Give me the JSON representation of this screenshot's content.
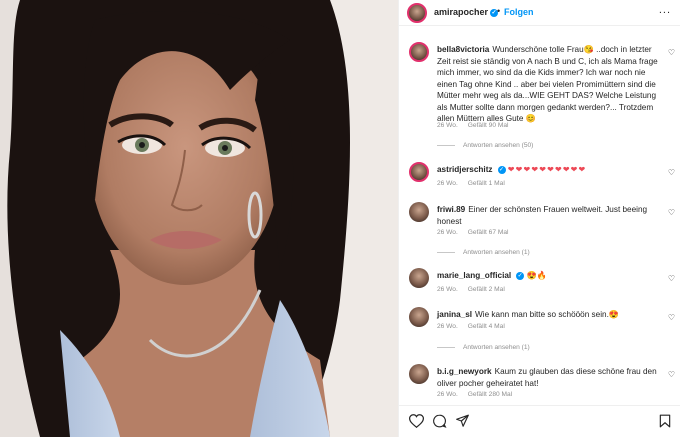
{
  "header": {
    "username": "amirapocher",
    "separator": "•",
    "follow_label": "Folgen",
    "more": "..."
  },
  "comments": [
    {
      "user": "bella8victoria",
      "text": "Wunderschöne tolle Frau😘 ..doch in letzter Zeit reist sie ständig von A nach B und C, ich als Mama frage mich immer, wo sind da die Kids immer? Ich war noch nie einen Tag ohne Kind .. aber bei vielen Promimüttern sind die Mütter mehr weg als da...WIE GEHT DAS? Welche Leistung als Mutter sollte dann morgen gedankt werden?... Trotzdem allen Müttern alles Gute 😊",
      "age": "26 Wo.",
      "likes": "Gefällt 90 Mal",
      "replies": "Antworten ansehen (50)"
    },
    {
      "user": "astridjerschitz",
      "text": "❤❤❤❤❤❤❤❤❤❤",
      "age": "26 Wo.",
      "likes": "Gefällt 1 Mal"
    },
    {
      "user": "friwi.89",
      "text": "Einer der schönsten Frauen weltweit. Just beeing honest",
      "age": "26 Wo.",
      "likes": "Gefällt 67 Mal",
      "replies": "Antworten ansehen (1)"
    },
    {
      "user": "marie_lang_official",
      "text": "😍🔥",
      "age": "26 Wo.",
      "likes": "Gefällt 2 Mal"
    },
    {
      "user": "janina_sl",
      "text": "Wie kann man bitte so schööön sein.😍",
      "age": "26 Wo.",
      "likes": "Gefällt 4 Mal",
      "replies": "Antworten ansehen (1)"
    },
    {
      "user": "b.i.g_newyork",
      "text": "Kaum zu glauben das diese schöne frau den oliver pocher geheiratet hat!",
      "age": "26 Wo.",
      "likes": "Gefällt 280 Mal"
    }
  ],
  "icons": {
    "like": "heart-icon",
    "comment": "comment-icon",
    "share": "share-icon",
    "save": "bookmark-icon"
  },
  "colors": {
    "accent": "#0095f6",
    "story_ring": "#e1306c",
    "heart_emoji": "#ed4956"
  }
}
